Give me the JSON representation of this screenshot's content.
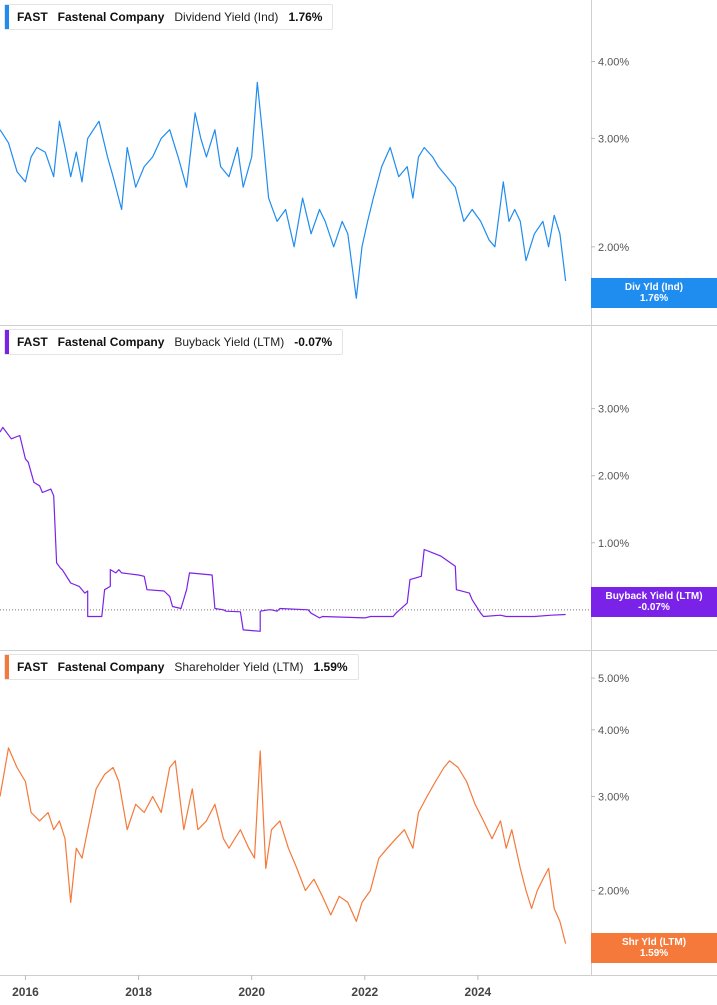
{
  "ticker": "FAST",
  "company": "Fastenal Company",
  "chart_data": {
    "type": "line",
    "x_axis": {
      "ticks": [
        "2016",
        "2018",
        "2020",
        "2022",
        "2024"
      ],
      "range": [
        2015.55,
        2026.0
      ]
    },
    "panels": [
      {
        "id": "div",
        "metric": "Dividend Yield (Ind)",
        "current_value": "1.76%",
        "tag_label": "Div Yld (Ind)",
        "tag_value": "1.76%",
        "color": "#1f8cf0",
        "scale": "log",
        "ylim": [
          1.55,
          4.5
        ],
        "yticks": [
          {
            "v": 4.0,
            "l": "4.00%"
          },
          {
            "v": 3.0,
            "l": "3.00%"
          },
          {
            "v": 2.0,
            "l": "2.00%"
          }
        ],
        "series": {
          "x": [
            2015.55,
            2015.7,
            2015.85,
            2016.0,
            2016.1,
            2016.2,
            2016.35,
            2016.5,
            2016.6,
            2016.7,
            2016.8,
            2016.9,
            2017.0,
            2017.1,
            2017.3,
            2017.45,
            2017.55,
            2017.7,
            2017.8,
            2017.95,
            2018.1,
            2018.25,
            2018.4,
            2018.55,
            2018.7,
            2018.85,
            2019.0,
            2019.1,
            2019.2,
            2019.35,
            2019.45,
            2019.6,
            2019.75,
            2019.85,
            2020.0,
            2020.1,
            2020.2,
            2020.3,
            2020.45,
            2020.6,
            2020.75,
            2020.9,
            2021.05,
            2021.2,
            2021.3,
            2021.45,
            2021.6,
            2021.7,
            2021.85,
            2021.95,
            2022.05,
            2022.15,
            2022.3,
            2022.45,
            2022.6,
            2022.75,
            2022.85,
            2022.95,
            2023.05,
            2023.2,
            2023.3,
            2023.45,
            2023.6,
            2023.75,
            2023.9,
            2024.05,
            2024.2,
            2024.3,
            2024.45,
            2024.55,
            2024.65,
            2024.75,
            2024.85,
            2025.0,
            2025.15,
            2025.25,
            2025.35,
            2025.45,
            2025.55
          ],
          "y": [
            3.1,
            2.95,
            2.65,
            2.55,
            2.8,
            2.9,
            2.85,
            2.6,
            3.2,
            2.9,
            2.6,
            2.85,
            2.55,
            3.0,
            3.2,
            2.8,
            2.6,
            2.3,
            2.9,
            2.5,
            2.7,
            2.8,
            3.0,
            3.1,
            2.8,
            2.5,
            3.3,
            3.0,
            2.8,
            3.1,
            2.7,
            2.6,
            2.9,
            2.5,
            2.8,
            3.7,
            3.0,
            2.4,
            2.2,
            2.3,
            2.0,
            2.4,
            2.1,
            2.3,
            2.2,
            2.0,
            2.2,
            2.1,
            1.65,
            2.0,
            2.2,
            2.4,
            2.7,
            2.9,
            2.6,
            2.7,
            2.4,
            2.8,
            2.9,
            2.8,
            2.7,
            2.6,
            2.5,
            2.2,
            2.3,
            2.2,
            2.05,
            2.0,
            2.55,
            2.2,
            2.3,
            2.2,
            1.9,
            2.1,
            2.2,
            2.0,
            2.25,
            2.1,
            1.76
          ]
        }
      },
      {
        "id": "buyback",
        "metric": "Buyback Yield (LTM)",
        "current_value": "-0.07%",
        "tag_label": "Buyback Yield (LTM)",
        "tag_value": "-0.07%",
        "color": "#7b22e8",
        "scale": "linear",
        "ylim": [
          -0.45,
          3.8
        ],
        "yticks": [
          {
            "v": 3.0,
            "l": "3.00%"
          },
          {
            "v": 2.0,
            "l": "2.00%"
          },
          {
            "v": 1.0,
            "l": "1.00%"
          }
        ],
        "zero_line": true,
        "series": {
          "x": [
            2015.55,
            2015.6,
            2015.75,
            2015.9,
            2016.0,
            2016.05,
            2016.15,
            2016.25,
            2016.3,
            2016.45,
            2016.5,
            2016.55,
            2016.62,
            2016.65,
            2016.8,
            2016.95,
            2017.05,
            2017.1,
            2017.1,
            2017.35,
            2017.4,
            2017.5,
            2017.5,
            2017.6,
            2017.65,
            2017.7,
            2018.0,
            2018.1,
            2018.15,
            2018.45,
            2018.55,
            2018.6,
            2018.75,
            2018.85,
            2018.9,
            2019.3,
            2019.35,
            2019.5,
            2019.55,
            2019.8,
            2019.85,
            2020.15,
            2020.15,
            2020.3,
            2020.35,
            2020.45,
            2020.5,
            2021.0,
            2021.05,
            2021.2,
            2021.25,
            2022.0,
            2022.1,
            2022.5,
            2022.55,
            2022.75,
            2022.8,
            2023.0,
            2023.05,
            2023.2,
            2023.35,
            2023.6,
            2023.62,
            2023.85,
            2023.9,
            2024.05,
            2024.1,
            2024.4,
            2024.5,
            2025.0,
            2025.3,
            2025.55
          ],
          "y": [
            2.65,
            2.72,
            2.55,
            2.6,
            2.25,
            2.2,
            1.9,
            1.85,
            1.75,
            1.8,
            1.7,
            0.7,
            0.62,
            0.6,
            0.4,
            0.35,
            0.25,
            0.28,
            -0.1,
            -0.1,
            0.3,
            0.35,
            0.6,
            0.55,
            0.6,
            0.55,
            0.52,
            0.5,
            0.3,
            0.28,
            0.2,
            0.05,
            0.02,
            0.3,
            0.55,
            0.52,
            0.02,
            0.0,
            -0.02,
            -0.03,
            -0.3,
            -0.32,
            -0.02,
            0.0,
            0.0,
            -0.02,
            0.02,
            0.0,
            -0.05,
            -0.12,
            -0.1,
            -0.12,
            -0.1,
            -0.1,
            -0.05,
            0.1,
            0.45,
            0.5,
            0.9,
            0.85,
            0.8,
            0.65,
            0.3,
            0.25,
            0.15,
            -0.05,
            -0.1,
            -0.08,
            -0.1,
            -0.1,
            -0.08,
            -0.07
          ]
        }
      },
      {
        "id": "shr",
        "metric": "Shareholder Yield (LTM)",
        "current_value": "1.59%",
        "tag_label": "Shr Yld (LTM)",
        "tag_value": "1.59%",
        "color": "#f5793a",
        "scale": "log",
        "ylim": [
          1.45,
          5.5
        ],
        "yticks": [
          {
            "v": 5.0,
            "l": "5.00%"
          },
          {
            "v": 4.0,
            "l": "4.00%"
          },
          {
            "v": 3.0,
            "l": "3.00%"
          },
          {
            "v": 2.0,
            "l": "2.00%"
          }
        ],
        "series": {
          "x": [
            2015.55,
            2015.7,
            2015.85,
            2016.0,
            2016.1,
            2016.25,
            2016.4,
            2016.5,
            2016.6,
            2016.7,
            2016.8,
            2016.9,
            2017.0,
            2017.1,
            2017.25,
            2017.4,
            2017.55,
            2017.65,
            2017.8,
            2017.95,
            2018.1,
            2018.25,
            2018.4,
            2018.55,
            2018.65,
            2018.8,
            2018.95,
            2019.05,
            2019.2,
            2019.35,
            2019.5,
            2019.6,
            2019.8,
            2019.95,
            2020.05,
            2020.15,
            2020.25,
            2020.35,
            2020.5,
            2020.65,
            2020.8,
            2020.95,
            2021.1,
            2021.25,
            2021.4,
            2021.55,
            2021.7,
            2021.85,
            2021.95,
            2022.1,
            2022.25,
            2022.4,
            2022.55,
            2022.7,
            2022.85,
            2022.95,
            2023.1,
            2023.25,
            2023.4,
            2023.5,
            2023.65,
            2023.8,
            2023.95,
            2024.1,
            2024.25,
            2024.4,
            2024.5,
            2024.6,
            2024.75,
            2024.85,
            2024.95,
            2025.05,
            2025.15,
            2025.25,
            2025.35,
            2025.45,
            2025.55
          ],
          "y": [
            3.0,
            3.7,
            3.4,
            3.2,
            2.8,
            2.7,
            2.8,
            2.6,
            2.7,
            2.5,
            1.9,
            2.4,
            2.3,
            2.6,
            3.1,
            3.3,
            3.4,
            3.2,
            2.6,
            2.9,
            2.8,
            3.0,
            2.8,
            3.4,
            3.5,
            2.6,
            3.1,
            2.6,
            2.7,
            2.9,
            2.5,
            2.4,
            2.6,
            2.4,
            2.3,
            3.65,
            2.2,
            2.6,
            2.7,
            2.4,
            2.2,
            2.0,
            2.1,
            1.95,
            1.8,
            1.95,
            1.9,
            1.75,
            1.9,
            2.0,
            2.3,
            2.4,
            2.5,
            2.6,
            2.4,
            2.8,
            3.0,
            3.2,
            3.4,
            3.5,
            3.4,
            3.2,
            2.9,
            2.7,
            2.5,
            2.7,
            2.4,
            2.6,
            2.2,
            2.0,
            1.85,
            2.0,
            2.1,
            2.2,
            1.85,
            1.75,
            1.59
          ]
        }
      }
    ]
  }
}
